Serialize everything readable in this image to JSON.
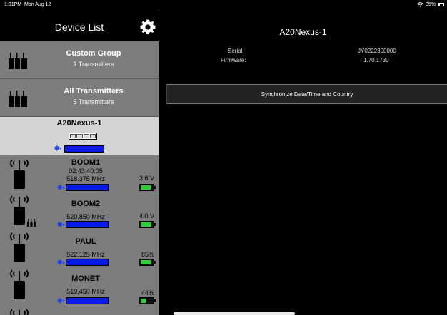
{
  "status": {
    "time": "1:31PM",
    "date": "Mon Aug 12",
    "battery": "35%"
  },
  "sidebar": {
    "title": "Device List",
    "groups": [
      {
        "name": "Custom Group",
        "sub": "1 Transmitters"
      },
      {
        "name": "All Transmitters",
        "sub": "5 Transmitters"
      }
    ],
    "selected_device": {
      "name": "A20Nexus-1"
    },
    "transmitters": [
      {
        "name": "BOOM1",
        "line1": "02:43:40:05",
        "freq": "518.375 MHz",
        "level": "3.6 V",
        "battery_fill": 0.85
      },
      {
        "name": "BOOM2",
        "line1": "",
        "freq": "520.850 MHz",
        "level": "4.0 V",
        "battery_fill": 0.9
      },
      {
        "name": "PAUL",
        "line1": "",
        "freq": "522.125 MHz",
        "level": "85%",
        "battery_fill": 0.85
      },
      {
        "name": "MONET",
        "line1": "",
        "freq": "519.450 MHz",
        "level": "44%",
        "battery_fill": 0.44
      }
    ]
  },
  "main": {
    "title": "A20Nexus-1",
    "serial_label": "Serial:",
    "serial_value": "JY0222300000",
    "firmware_label": "Firmware:",
    "firmware_value": "1.70.1730",
    "sync_button": "Synchronize Date/Time and Country"
  },
  "icons": [
    "gear-icon",
    "wifi-icon",
    "battery-icon",
    "bluetooth-icon",
    "transmitter-icon",
    "group-icon"
  ],
  "colors": {
    "row_gray": "#7d7d7d",
    "selected_gray": "#d4d4d4",
    "signal_blue": "#0a1ae6",
    "battery_green": "#2fce3a"
  }
}
